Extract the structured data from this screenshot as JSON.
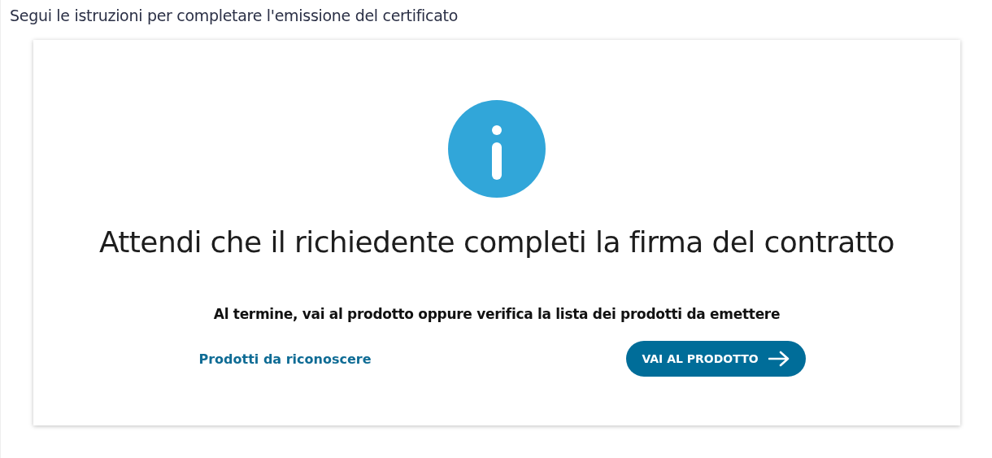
{
  "instructions": "Segui le istruzioni per completare l'emissione del certificato",
  "card": {
    "title": "Attendi che il richiedente completi la firma del contratto",
    "subtitle": "Al termine, vai al prodotto oppure verifica la lista dei prodotti da emettere",
    "link": "Prodotti da riconoscere",
    "button": "VAI AL PRODOTTO"
  }
}
